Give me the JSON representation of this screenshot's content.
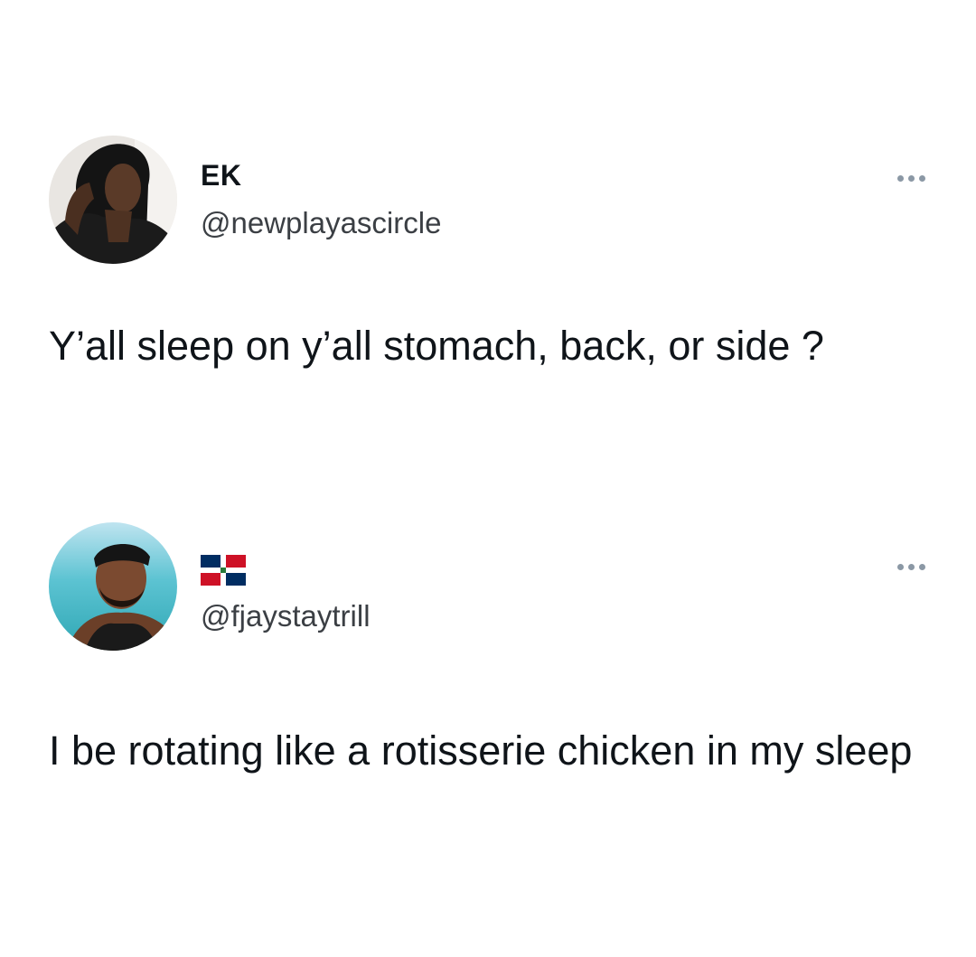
{
  "tweets": [
    {
      "display_name": "EK",
      "handle": "@newplayascircle",
      "text": "Y’all sleep on y’all stomach, back, or side ?",
      "avatar_icon": "profile-photo",
      "more_icon": "more-options-icon"
    },
    {
      "display_name_icon": "dominican-republic-flag-icon",
      "handle": "@fjaystaytrill",
      "text": "I be rotating like a rotisserie chicken in my sleep",
      "avatar_icon": "profile-photo",
      "more_icon": "more-options-icon"
    }
  ],
  "colors": {
    "background": "#ffffff",
    "text": "#0f1419",
    "handle": "#3b3f44",
    "more_dots": "#8b98a5"
  }
}
